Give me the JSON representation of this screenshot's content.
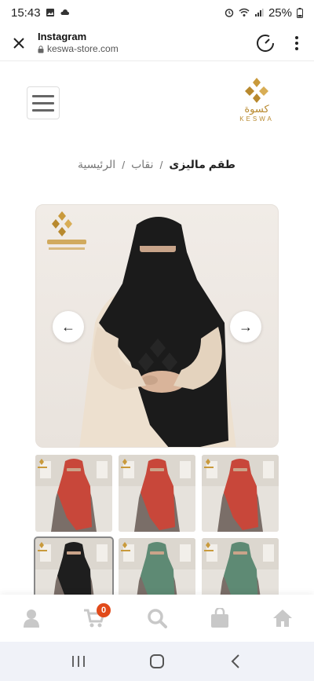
{
  "status_bar": {
    "time": "15:43",
    "battery": "25%"
  },
  "browser": {
    "app_title": "Instagram",
    "url": "keswa-store.com"
  },
  "logo": {
    "arabic": "كسوة",
    "latin": "KESWA"
  },
  "breadcrumb": {
    "items": [
      "الرئيسية",
      "نقاب"
    ],
    "separator": "/",
    "current": "طقم ماليزى"
  },
  "gallery": {
    "prev_arrow": "←",
    "next_arrow": "→",
    "thumbnails": [
      {
        "color": "#c8473a"
      },
      {
        "color": "#c8473a"
      },
      {
        "color": "#c8473a"
      },
      {
        "color": "#1e1e1e"
      },
      {
        "color": "#5e8a74"
      },
      {
        "color": "#5e8a74"
      }
    ]
  },
  "bottom_nav": {
    "cart_count": "0",
    "icons": [
      "user-icon",
      "cart-icon",
      "search-icon",
      "shopping-bag-icon",
      "home-icon"
    ]
  },
  "colors": {
    "brand_gold": "#b8892e",
    "badge": "#e14a1a"
  }
}
